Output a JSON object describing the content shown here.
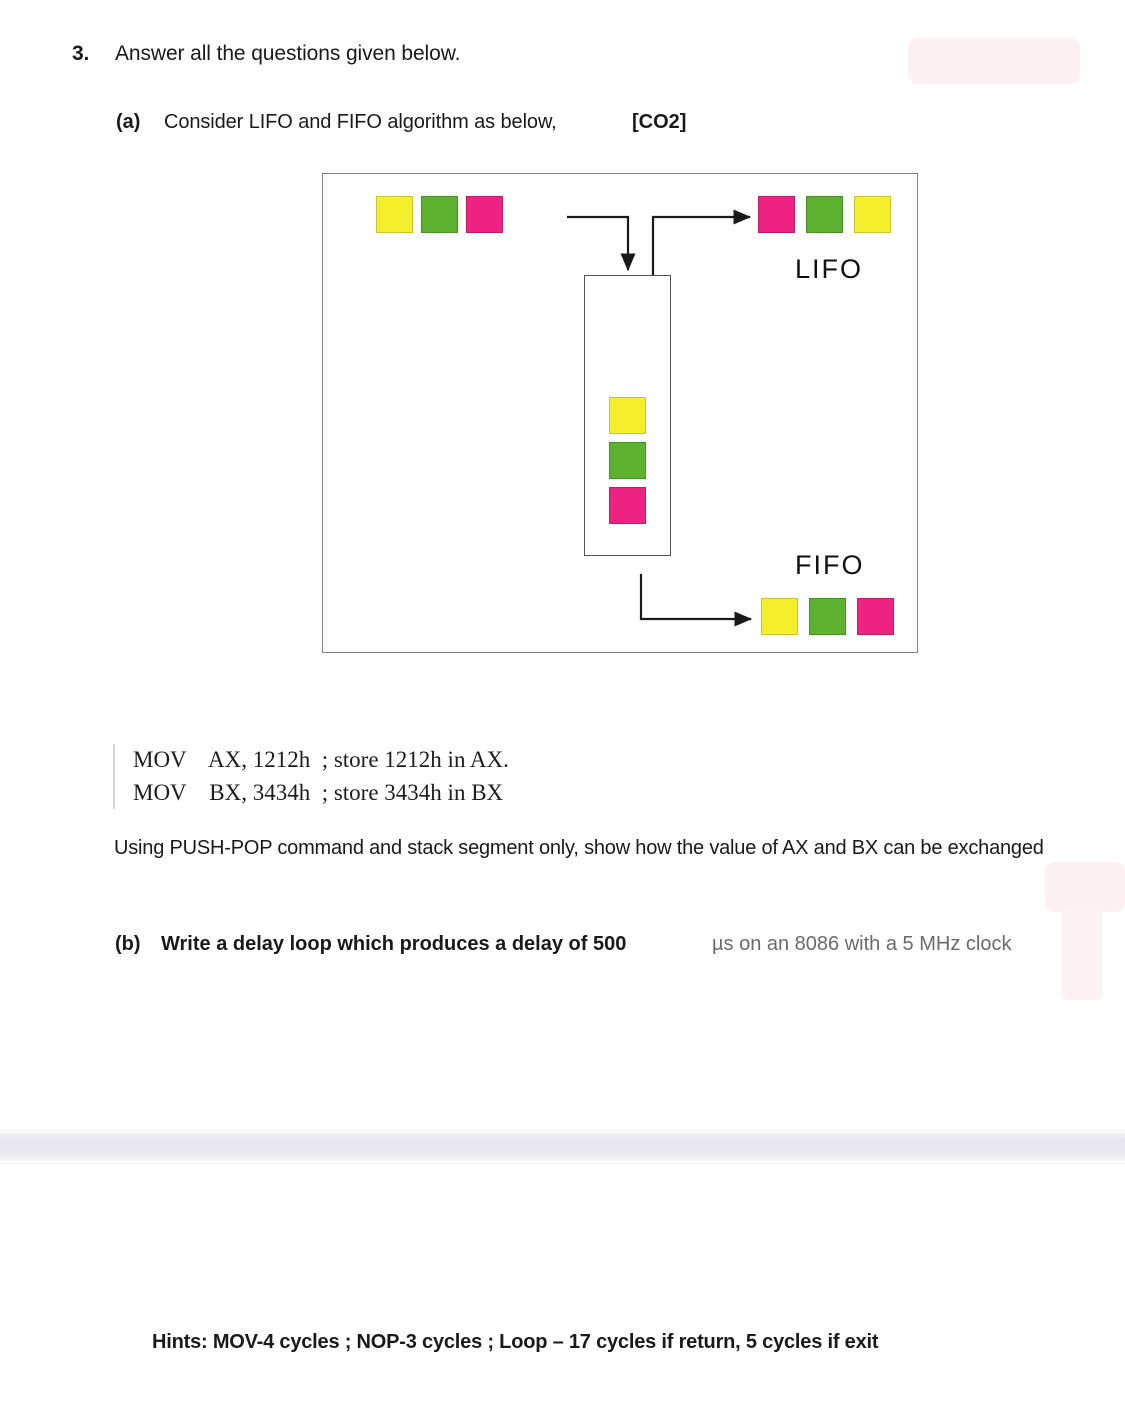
{
  "question": {
    "number": "3.",
    "title": "Answer all the questions given below."
  },
  "part_a": {
    "label": "(a)",
    "text": "Consider LIFO and FIFO algorithm as below,",
    "course_outcome": "[CO2]"
  },
  "diagram": {
    "input_blocks": [
      "yellow",
      "green",
      "pink"
    ],
    "stack_blocks": [
      "yellow",
      "green",
      "pink"
    ],
    "lifo_output_blocks": [
      "pink",
      "green",
      "yellow"
    ],
    "fifo_output_blocks": [
      "yellow",
      "green",
      "pink"
    ],
    "lifo_label": "LIFO",
    "fifo_label": "FIFO",
    "colors": {
      "yellow": "#f4ef2b",
      "green": "#5cb22e",
      "pink": "#ee2280",
      "border": "#808080",
      "stack_border": "#555555",
      "arrow": "#1a1a1a"
    }
  },
  "code": {
    "lines": [
      "MOV    AX, 1212h  ; store 1212h in AX.",
      "MOV    BX, 3434h  ; store 3434h in BX"
    ],
    "text": "MOV    AX, 1212h  ; store 1212h in AX.\nMOV    BX, 3434h  ; store 3434h in BX"
  },
  "exchange_paragraph": "Using PUSH-POP command and stack segment only, show how the value of AX and BX can be exchanged",
  "part_b": {
    "label": "(b)",
    "text_strong": "Write a delay loop which produces a delay of 500",
    "text_rest": "µs on an 8086 with a 5 MHz clock"
  },
  "hints": "Hints: MOV-4 cycles ; NOP-3 cycles ; Loop – 17 cycles if return, 5 cycles if exit"
}
